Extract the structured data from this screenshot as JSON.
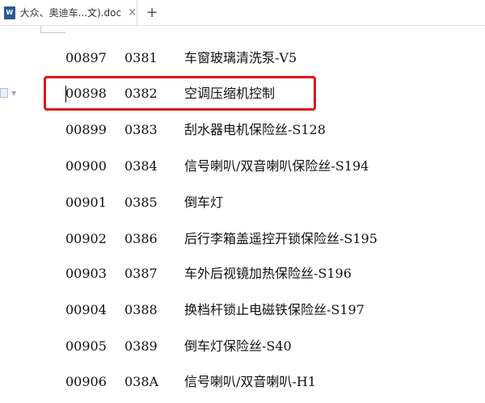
{
  "tab": {
    "doc_icon": "W",
    "title": "大众、奥迪车...文).doc",
    "close": "×"
  },
  "new_tab": "+",
  "rows": [
    {
      "code": "00897",
      "hex": "0381",
      "desc": "车窗玻璃清洗泵-V5"
    },
    {
      "code": "00898",
      "hex": "0382",
      "desc": "空调压缩机控制"
    },
    {
      "code": "00899",
      "hex": "0383",
      "desc": "刮水器电机保险丝-S128"
    },
    {
      "code": "00900",
      "hex": "0384",
      "desc": "信号喇叭/双音喇叭保险丝-S194"
    },
    {
      "code": "00901",
      "hex": "0385",
      "desc": "倒车灯"
    },
    {
      "code": "00902",
      "hex": "0386",
      "desc": "后行李箱盖遥控开锁保险丝-S195"
    },
    {
      "code": "00903",
      "hex": "0387",
      "desc": "车外后视镜加热保险丝-S196"
    },
    {
      "code": "00904",
      "hex": "0388",
      "desc": "换档杆锁止电磁铁保险丝-S197"
    },
    {
      "code": "00905",
      "hex": "0389",
      "desc": "倒车灯保险丝-S40"
    },
    {
      "code": "00906",
      "hex": "038A",
      "desc": "信号喇叭/双音喇叭-H1"
    }
  ],
  "highlight_color": "#e1141b"
}
